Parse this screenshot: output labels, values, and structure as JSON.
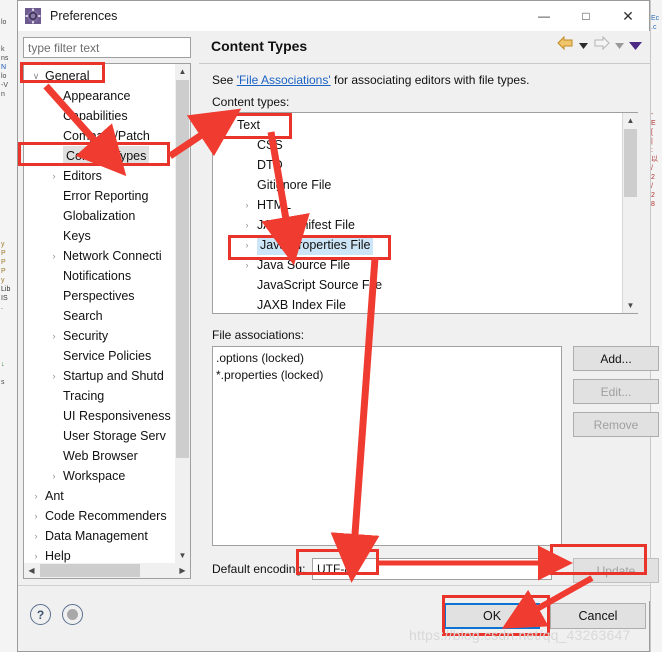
{
  "window": {
    "title": "Preferences",
    "icon": "preferences-gear-icon",
    "minimize": "—",
    "maximize": "□",
    "close": "✕"
  },
  "filter": {
    "placeholder": "type filter text",
    "value": ""
  },
  "sidebar": {
    "items": [
      {
        "label": "General",
        "indent": 0,
        "twisty": "expanded",
        "selected": false
      },
      {
        "label": "Appearance",
        "indent": 1,
        "twisty": "collapsed",
        "selected": false
      },
      {
        "label": "Capabilities",
        "indent": 1,
        "twisty": "none",
        "selected": false
      },
      {
        "label": "Compare/Patch",
        "indent": 1,
        "twisty": "none",
        "selected": false
      },
      {
        "label": "Content Types",
        "indent": 1,
        "twisty": "none",
        "selected": true
      },
      {
        "label": "Editors",
        "indent": 1,
        "twisty": "collapsed",
        "selected": false
      },
      {
        "label": "Error Reporting",
        "indent": 1,
        "twisty": "none",
        "selected": false
      },
      {
        "label": "Globalization",
        "indent": 1,
        "twisty": "none",
        "selected": false
      },
      {
        "label": "Keys",
        "indent": 1,
        "twisty": "none",
        "selected": false
      },
      {
        "label": "Network Connecti",
        "indent": 1,
        "twisty": "collapsed",
        "selected": false
      },
      {
        "label": "Notifications",
        "indent": 1,
        "twisty": "none",
        "selected": false
      },
      {
        "label": "Perspectives",
        "indent": 1,
        "twisty": "none",
        "selected": false
      },
      {
        "label": "Search",
        "indent": 1,
        "twisty": "none",
        "selected": false
      },
      {
        "label": "Security",
        "indent": 1,
        "twisty": "collapsed",
        "selected": false
      },
      {
        "label": "Service Policies",
        "indent": 1,
        "twisty": "none",
        "selected": false
      },
      {
        "label": "Startup and Shutd",
        "indent": 1,
        "twisty": "collapsed",
        "selected": false
      },
      {
        "label": "Tracing",
        "indent": 1,
        "twisty": "none",
        "selected": false
      },
      {
        "label": "UI Responsiveness",
        "indent": 1,
        "twisty": "none",
        "selected": false
      },
      {
        "label": "User Storage Serv",
        "indent": 1,
        "twisty": "none",
        "selected": false
      },
      {
        "label": "Web Browser",
        "indent": 1,
        "twisty": "none",
        "selected": false
      },
      {
        "label": "Workspace",
        "indent": 1,
        "twisty": "collapsed",
        "selected": false
      },
      {
        "label": "Ant",
        "indent": 0,
        "twisty": "collapsed",
        "selected": false
      },
      {
        "label": "Code Recommenders",
        "indent": 0,
        "twisty": "collapsed",
        "selected": false
      },
      {
        "label": "Data Management",
        "indent": 0,
        "twisty": "collapsed",
        "selected": false
      },
      {
        "label": "Help",
        "indent": 0,
        "twisty": "collapsed",
        "selected": false
      }
    ]
  },
  "content": {
    "title": "Content Types",
    "see_prefix": "See ",
    "see_link": "'File Associations'",
    "see_suffix": " for associating editors with file types.",
    "content_types_label": "Content types:",
    "nav": {
      "back": "back-arrow-icon",
      "back_menu": "back-dropdown-icon",
      "forward": "forward-arrow-icon",
      "forward_menu": "forward-dropdown-icon",
      "view_menu": "view-menu-dropdown-icon"
    },
    "types": [
      {
        "label": "Text",
        "indent": 0,
        "twisty": "expanded",
        "selected": false
      },
      {
        "label": "CSS",
        "indent": 1,
        "twisty": "none",
        "selected": false
      },
      {
        "label": "DTD",
        "indent": 1,
        "twisty": "none",
        "selected": false
      },
      {
        "label": "Gitignore File",
        "indent": 1,
        "twisty": "none",
        "selected": false
      },
      {
        "label": "HTML",
        "indent": 1,
        "twisty": "collapsed",
        "selected": false
      },
      {
        "label": "JAR Manifest File",
        "indent": 1,
        "twisty": "collapsed",
        "selected": false
      },
      {
        "label": "Java Properties File",
        "indent": 1,
        "twisty": "collapsed",
        "selected": true
      },
      {
        "label": "Java Source File",
        "indent": 1,
        "twisty": "collapsed",
        "selected": false
      },
      {
        "label": "JavaScript Source File",
        "indent": 1,
        "twisty": "none",
        "selected": false
      },
      {
        "label": "JAXB Index File",
        "indent": 1,
        "twisty": "none",
        "selected": false
      }
    ],
    "file_associations_label": "File associations:",
    "file_associations": [
      ".options (locked)",
      "*.properties (locked)"
    ],
    "buttons": {
      "add": "Add...",
      "edit": "Edit...",
      "remove": "Remove",
      "update": "Update"
    },
    "encoding_label": "Default encoding:",
    "encoding_value": "UTF-8"
  },
  "footer": {
    "help": "?",
    "restore": "restore-defaults-icon",
    "ok": "OK",
    "cancel": "Cancel"
  },
  "watermark": "https://blog.csdn.net/qq_43263647",
  "colors": {
    "annotation_red": "#e8342a",
    "focus_blue": "#0a74d0",
    "selection_blue": "#cde6f7",
    "link_blue": "#1a63c4",
    "back_arrow_gold": "#e8a33d",
    "view_menu_purple": "#4b2a86"
  }
}
